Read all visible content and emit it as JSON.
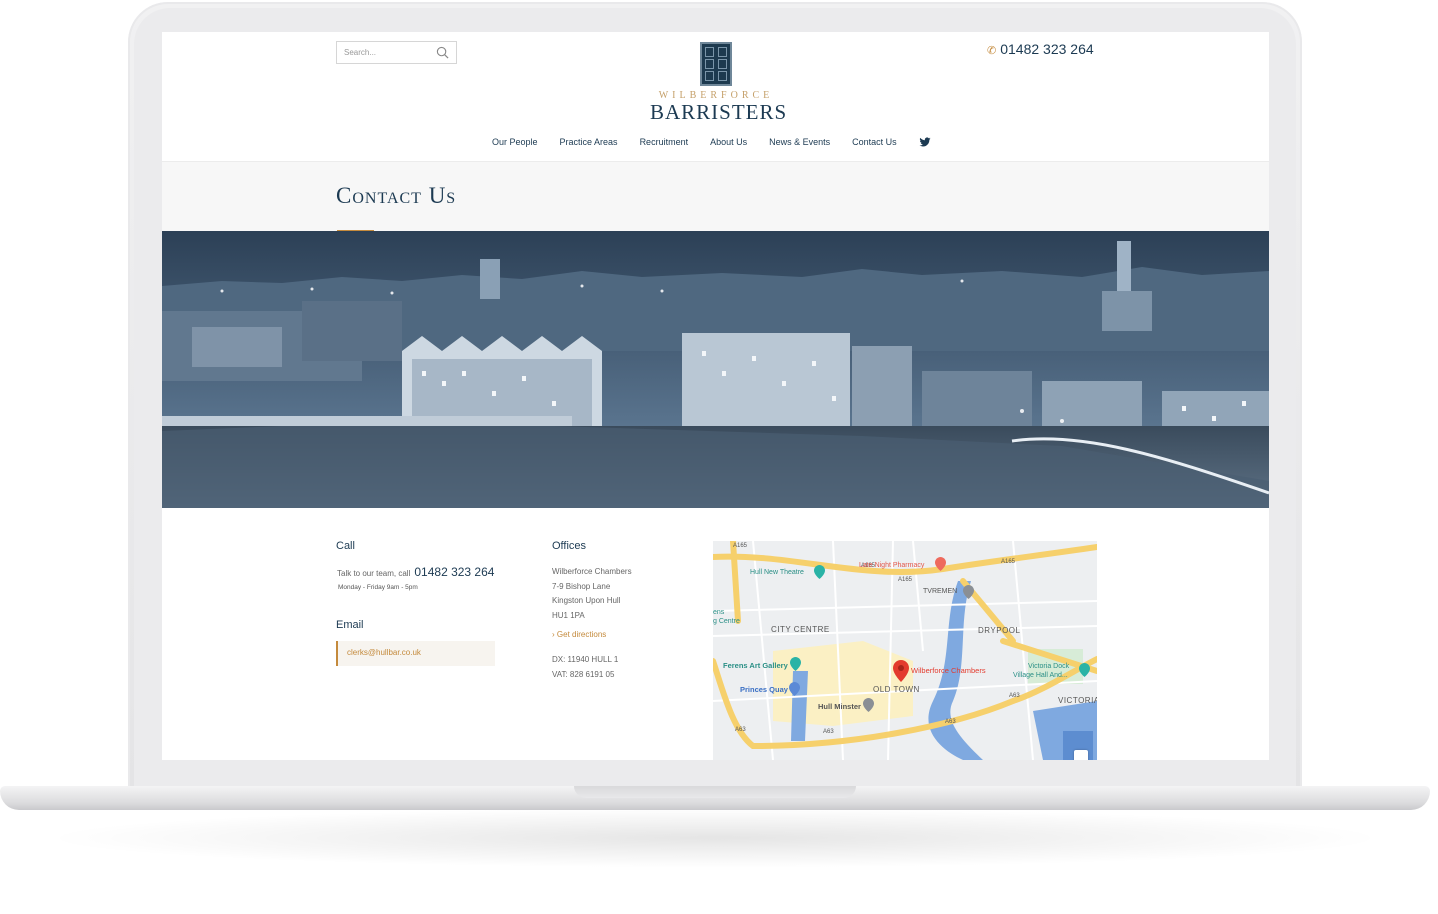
{
  "header": {
    "search_placeholder": "Search...",
    "logo_top": "WILBERFORCE",
    "logo_main": "BARRISTERS",
    "phone": "01482 323 264",
    "nav": [
      "Our People",
      "Practice Areas",
      "Recruitment",
      "About Us",
      "News & Events",
      "Contact Us"
    ]
  },
  "page": {
    "title": "Contact Us"
  },
  "call": {
    "heading": "Call",
    "intro": "Talk to our team, call",
    "number": "01482 323 264",
    "hours": "Monday - Friday 9am - 5pm"
  },
  "email": {
    "heading": "Email",
    "address": "clerks@hullbar.co.uk"
  },
  "offices": {
    "heading": "Offices",
    "lines": [
      "Wilberforce Chambers",
      "7-9 Bishop Lane",
      "Kingston Upon Hull",
      "HU1 1PA"
    ],
    "directions": "Get directions",
    "dx": "DX: 11940 HULL 1",
    "vat": "VAT: 828 6191 05"
  },
  "map": {
    "labels": {
      "a165_1": "A165",
      "a165_2": "A165",
      "a165_3": "A165",
      "a165_4": "A165",
      "hull_new_theatre": "Hull New Theatre",
      "late_night_pharmacy": "Late Night Pharmacy",
      "tvremen": "TVREMEN",
      "drypool": "DRYPOOL",
      "city_centre": "CITY CENTRE",
      "centre_partial": "g Centre",
      "ens_partial": "ens",
      "ferens": "Ferens Art Gallery",
      "princes_quay": "Princes Quay",
      "wilberforce_chambers": "Wilberforce Chambers",
      "old_town": "OLD TOWN",
      "victoria_dock": "Victoria Dock",
      "village_hall": "Village Hall And...",
      "victoria": "VICTORIA",
      "hull_minster": "Hull Minster",
      "a63_1": "A63",
      "a63_2": "A63",
      "a63_3": "A63",
      "a63_4": "A63"
    }
  },
  "colors": {
    "navy": "#1c3a52",
    "gold": "#c48a3c",
    "map_road": "#f6d06c",
    "map_water": "#7fa9e0",
    "pin": "#e33b2e"
  }
}
